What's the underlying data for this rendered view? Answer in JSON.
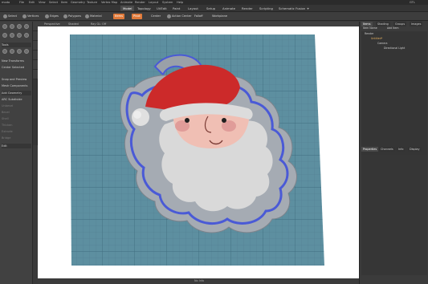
{
  "titlebar": {
    "app_name": "modo",
    "menus": [
      "File",
      "Edit",
      "View",
      "Select",
      "Item",
      "Geometry",
      "Texture",
      "Vertex Map",
      "Animate",
      "Render",
      "Layout",
      "System",
      "Help"
    ],
    "right_label": "GTL"
  },
  "tabs": [
    "Model",
    "Topology",
    "UVEdit",
    "Paint",
    "Layout",
    "Setup",
    "Animate",
    "Render",
    "Scripting",
    "Schematic Fusion"
  ],
  "active_tab": "Model",
  "toolbar": {
    "buttons": [
      "Select",
      "Vertices",
      "Edges",
      "Polygons",
      "Material",
      "Items",
      "Pivot",
      "Center",
      "Action Center",
      "Falloff",
      "Workplane"
    ],
    "highlight": [
      "Items",
      "Pivot"
    ]
  },
  "left_panel": {
    "rows": [
      "Tools",
      "New Transforms",
      "Center Selected",
      "",
      "Snap and Preview",
      "Mesh Components",
      "",
      "Add Geometry",
      "ARC Subdivide",
      "Unbevel",
      "Bevel",
      "Shell",
      "Thicken",
      "Extrude",
      "Bridge",
      "Edit"
    ]
  },
  "viewport": {
    "header": [
      "Perspective",
      "Shaded",
      "Ray GL: Off"
    ],
    "status_text": "No Info"
  },
  "right_panel": {
    "tabs": [
      "Items",
      "Shading",
      "Groups",
      "Images"
    ],
    "list_header": [
      "Item Name",
      "Add Item"
    ],
    "items": [
      "Render",
      "Untitled*",
      "Camera",
      "Directional Light"
    ],
    "bottom_tabs": [
      "Properties",
      "Channels",
      "Info",
      "Display"
    ]
  },
  "colors": {
    "grid_bg": "#5d8fa0",
    "grid_line": "#3f6d80",
    "cutter_outer": "#9aa0a8",
    "cutter_blue": "#4a5ad6",
    "hat_red": "#cc2a2a",
    "beard": "#d9d9d9",
    "skin": "#f0bfb4"
  }
}
